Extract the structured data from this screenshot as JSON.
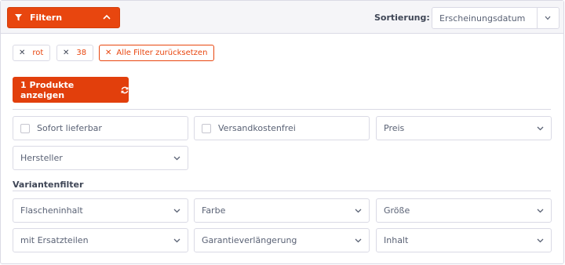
{
  "toolbar": {
    "filter_label": "Filtern",
    "sort_label": "Sortierung:",
    "sort_value": "Erscheinungsdatum"
  },
  "active_filters": [
    {
      "label": "rot"
    },
    {
      "label": "38"
    }
  ],
  "reset_label": "Alle Filter zurücksetzen",
  "show_products_label": "1 Produkte anzeigen",
  "filters": {
    "immediate_delivery": "Sofort lieferbar",
    "free_shipping": "Versandkostenfrei",
    "price": "Preis",
    "manufacturer": "Hersteller"
  },
  "variant_section_title": "Variantenfilter",
  "variant_filters": [
    {
      "label": "Flascheninhalt"
    },
    {
      "label": "Farbe"
    },
    {
      "label": "Größe"
    },
    {
      "label": "mit Ersatzteilen"
    },
    {
      "label": "Garantieverlängerung"
    },
    {
      "label": "Inhalt"
    }
  ],
  "icons": {
    "filter": "funnel-icon",
    "collapse": "chevron-up-icon",
    "dropdown": "chevron-down-icon",
    "remove": "close-icon",
    "refresh": "refresh-icon"
  },
  "colors": {
    "accent": "#e8460f",
    "border": "#dadae5",
    "toolbar_bg": "#f5f5f8",
    "text": "#5a6275"
  }
}
